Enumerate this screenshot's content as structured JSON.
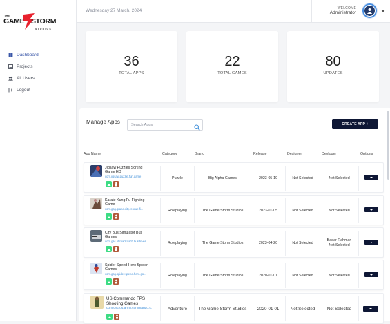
{
  "brand": {
    "logo_the": "THE",
    "logo_word1": "GAME",
    "logo_word2": "STORM",
    "logo_studios": "STUDIOS",
    "accent": "#e8212d"
  },
  "sidebar": {
    "items": [
      {
        "label": "Dashboard",
        "icon": "dashboard-icon",
        "active": true
      },
      {
        "label": "Projects",
        "icon": "projects-icon",
        "active": false
      },
      {
        "label": "All Users",
        "icon": "users-icon",
        "active": false
      },
      {
        "label": "Logout",
        "icon": "logout-icon",
        "active": false
      }
    ]
  },
  "header": {
    "date": "Wednesday 27 March, 2024",
    "welcome": "WELCOME",
    "user": "Administrator"
  },
  "stats": [
    {
      "value": "36",
      "label": "TOTAL APPS"
    },
    {
      "value": "22",
      "label": "TOTAL GAMES"
    },
    {
      "value": "80",
      "label": "UPDATES"
    }
  ],
  "manage": {
    "title": "Manage Apps",
    "search_placeholder": "Search Apps",
    "create_label": "CREATE APP +",
    "columns": [
      "App Name",
      "Category",
      "Brand",
      "Release",
      "Designer",
      "Devloper",
      "Options"
    ],
    "rows": [
      {
        "name": "Jigsaw Puzzles Sorting Game HD",
        "package": "com.jigsaw.puzzle.fun.game",
        "category": "Puzzle",
        "brand": "Big Alpha Games",
        "release": "2023-05-19",
        "designer": "Not Selected",
        "developer": "Not Selected"
      },
      {
        "name": "Karate Kung Fu Fighting Game",
        "package": "com.gsg.grand.city.rescue.fi...",
        "category": "Roleplaying",
        "brand": "The Game Storm Studios",
        "release": "2023-01-05",
        "designer": "Not Selected",
        "developer": "Not Selected"
      },
      {
        "name": "City Bus Simulator Bus Games",
        "package": "com.gsc.offroadcoach.busdriver",
        "category": "Roleplaying",
        "brand": "The Game Storm Studios",
        "release": "2023-04-20",
        "designer": "Not Selected",
        "developer": "Badar Rahman\nNot Selected"
      },
      {
        "name": "Spider Speed Hero Spider Games",
        "package": "com.gsg.spider.speed.hero.go...",
        "category": "Roleplaying",
        "brand": "The Game Storm Studios",
        "release": "2020-01-01",
        "designer": "Not Selected",
        "developer": "Not Selected"
      },
      {
        "name": "US Commando FPS Shooting Games",
        "package": "com.gsc.us.army.commando.s...",
        "category": "Adventure",
        "brand": "The Game Storm Studios",
        "release": "2020-01-01",
        "designer": "Not Selected",
        "developer": "Not Selected"
      }
    ]
  }
}
